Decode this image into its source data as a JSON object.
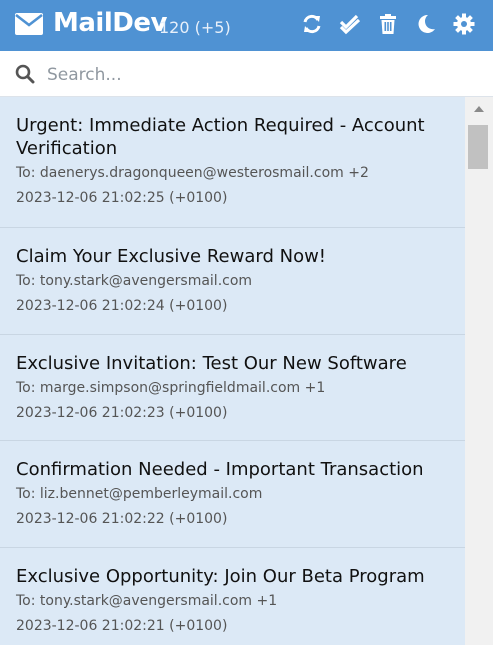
{
  "header": {
    "title": "MailDev",
    "count": "120 (+5)",
    "brand_icon": "envelope-icon",
    "toolbar": [
      {
        "name": "refresh-icon"
      },
      {
        "name": "mark-all-read-icon"
      },
      {
        "name": "trash-icon"
      },
      {
        "name": "dark-mode-icon"
      },
      {
        "name": "settings-icon"
      }
    ]
  },
  "search": {
    "placeholder": "Search..."
  },
  "emails": [
    {
      "subject": "Urgent: Immediate Action Required - Account Verification",
      "to": "To: daenerys.dragonqueen@westerosmail.com +2",
      "date": "2023-12-06 21:02:25 (+0100)"
    },
    {
      "subject": "Claim Your Exclusive Reward Now!",
      "to": "To: tony.stark@avengersmail.com",
      "date": "2023-12-06 21:02:24 (+0100)"
    },
    {
      "subject": "Exclusive Invitation: Test Our New Software",
      "to": "To: marge.simpson@springfieldmail.com +1",
      "date": "2023-12-06 21:02:23 (+0100)"
    },
    {
      "subject": "Confirmation Needed - Important Transaction",
      "to": "To: liz.bennet@pemberleymail.com",
      "date": "2023-12-06 21:02:22 (+0100)"
    },
    {
      "subject": "Exclusive Opportunity: Join Our Beta Program",
      "to": "To: tony.stark@avengersmail.com +1",
      "date": "2023-12-06 21:02:21 (+0100)"
    }
  ],
  "colors": {
    "header_bg": "#4f92d3",
    "list_bg": "#dce9f6"
  }
}
